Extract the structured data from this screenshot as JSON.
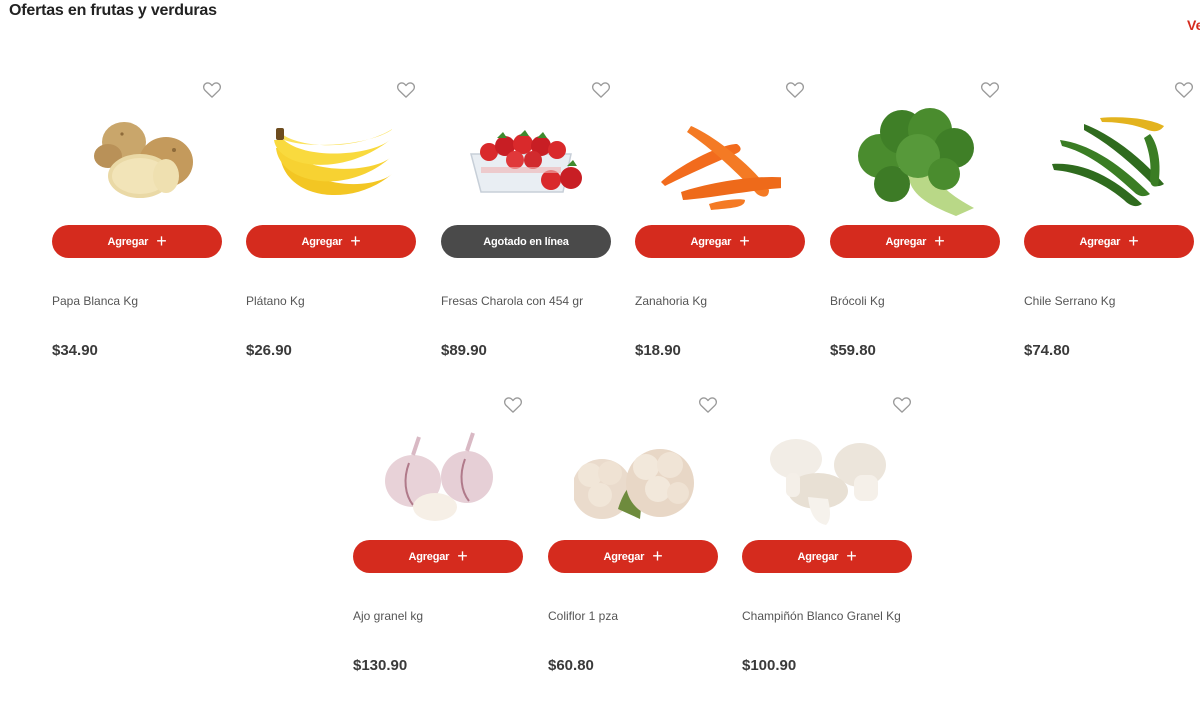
{
  "section": {
    "title": "Ofertas en frutas y verduras",
    "see_all": "Ve"
  },
  "products": [
    {
      "name": "Papa Blanca Kg",
      "price": "$34.90",
      "button": "Agregar",
      "available": true,
      "image": "potato"
    },
    {
      "name": "Plátano Kg",
      "price": "$26.90",
      "button": "Agregar",
      "available": true,
      "image": "banana"
    },
    {
      "name": "Fresas Charola con 454 gr",
      "price": "$89.90",
      "button": "Agotado en línea",
      "available": false,
      "image": "strawberry"
    },
    {
      "name": "Zanahoria Kg",
      "price": "$18.90",
      "button": "Agregar",
      "available": true,
      "image": "carrot"
    },
    {
      "name": "Brócoli Kg",
      "price": "$59.80",
      "button": "Agregar",
      "available": true,
      "image": "broccoli"
    },
    {
      "name": "Chile Serrano Kg",
      "price": "$74.80",
      "button": "Agregar",
      "available": true,
      "image": "chili"
    },
    {
      "name": "Ajo granel kg",
      "price": "$130.90",
      "button": "Agregar",
      "available": true,
      "image": "garlic"
    },
    {
      "name": "Coliflor 1 pza",
      "price": "$60.80",
      "button": "Agregar",
      "available": true,
      "image": "cauliflower"
    },
    {
      "name": "Champiñón Blanco Granel Kg",
      "price": "$100.90",
      "button": "Agregar",
      "available": true,
      "image": "mushroom"
    }
  ],
  "colors": {
    "accent": "#d52b1e",
    "sold_out": "#4a4a4a"
  }
}
